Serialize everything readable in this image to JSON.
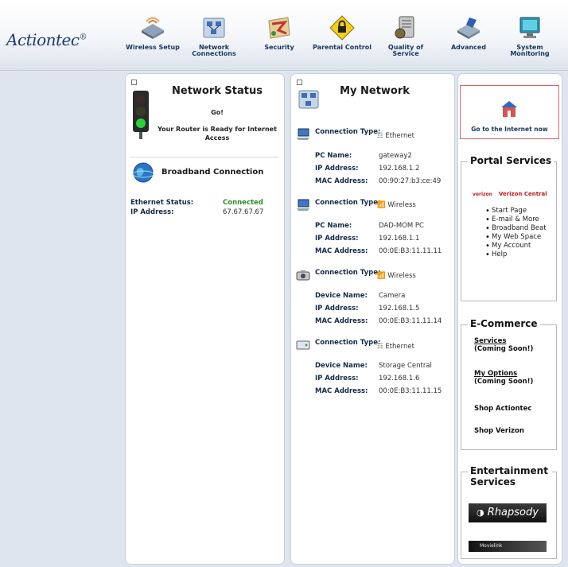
{
  "brand": {
    "logo_text": "Actiontec",
    "logo_mark": "®"
  },
  "nav": [
    {
      "label": "Wireless Setup",
      "icon": "wireless-setup-icon"
    },
    {
      "label": "Network Connections",
      "icon": "network-connections-icon"
    },
    {
      "label": "Security",
      "icon": "security-icon"
    },
    {
      "label": "Parental Control",
      "icon": "parental-control-icon"
    },
    {
      "label": "Quality of Service",
      "icon": "quality-of-service-icon"
    },
    {
      "label": "Advanced",
      "icon": "advanced-icon"
    },
    {
      "label": "System Monitoring",
      "icon": "system-monitoring-icon"
    }
  ],
  "network_status": {
    "title": "Network Status",
    "light_text": "Go!",
    "ready_text": "Your Router is Ready for Internet Access",
    "broadband_title": "Broadband Connection",
    "ethernet_status_label": "Ethernet Status:",
    "ethernet_status_value": "Connected",
    "ip_label": "IP Address:",
    "ip_value": "67.67.67.67",
    "colors": {
      "connected": "#2e8b2e"
    }
  },
  "my_network": {
    "title": "My Network",
    "devices": [
      {
        "type_label": "Connection Type:",
        "type": "Ethernet",
        "name_label": "PC Name:",
        "name": "gateway2",
        "ip_label": "IP Address:",
        "ip": "192.168.1.2",
        "mac_label": "MAC Address:",
        "mac": "00:90:27:b3:ce:49",
        "icon": "pc-icon"
      },
      {
        "type_label": "Connection Type:",
        "type": "Wireless",
        "name_label": "PC Name:",
        "name": "DAD-MOM PC",
        "ip_label": "IP Address:",
        "ip": "192.168.1.1",
        "mac_label": "MAC Address:",
        "mac": "00:0E:B3:11.11.11",
        "icon": "pc-icon"
      },
      {
        "type_label": "Connection Type:",
        "type": "Wireless",
        "name_label": "Device Name:",
        "name": "Camera",
        "ip_label": "IP Address:",
        "ip": "192.168.1.5",
        "mac_label": "MAC Address:",
        "mac": "00:0E:B3:11.11.14",
        "icon": "camera-icon"
      },
      {
        "type_label": "Connection Type:",
        "type": "Ethernet",
        "name_label": "Device Name:",
        "name": "Storage Central",
        "ip_label": "IP Address:",
        "ip": "192.168.1.6",
        "mac_label": "MAC Address:",
        "mac": "00:0E:B3:11.11.15",
        "icon": "storage-icon"
      }
    ]
  },
  "right": {
    "go_internet": "Go to the Internet now",
    "portal_title": "Portal Services",
    "portal_brand": "Verizon Central",
    "portal_items": [
      "Start Page",
      "E-mail & More",
      "Broadband Beat",
      "My Web Space",
      "My Account",
      "Help"
    ],
    "ecommerce_title": "E-Commerce",
    "services_link": "Services",
    "services_note": "(Coming Soon!)",
    "options_link": "My Options",
    "options_note": "(Coming Soon!)",
    "shop_actiontec": "Shop Actiontec",
    "shop_verizon": "Shop Verizon",
    "entertainment_title": "Entertainment Services",
    "rhapsody": "Rhapsody",
    "movielink": "Movielink"
  }
}
